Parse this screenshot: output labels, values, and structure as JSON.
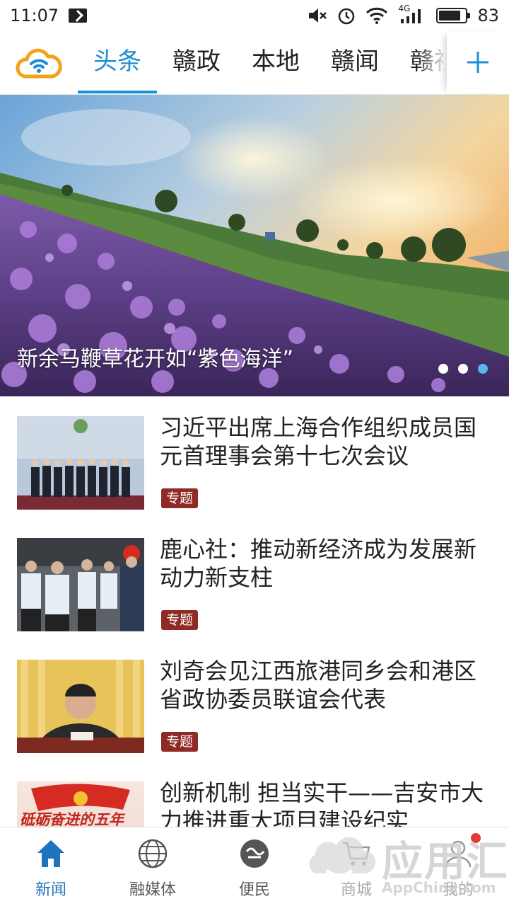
{
  "status_bar": {
    "time": "11:07",
    "battery_level": "83",
    "network": "4G"
  },
  "header": {
    "tabs": [
      {
        "label": "头条",
        "active": true
      },
      {
        "label": "赣政",
        "active": false
      },
      {
        "label": "本地",
        "active": false
      },
      {
        "label": "赣闻",
        "active": false
      },
      {
        "label": "赣社",
        "active": false
      }
    ],
    "add_icon": "plus-icon",
    "accent_color": "#1a8fd4"
  },
  "hero": {
    "caption": "新余马鞭草花开如“紫色海洋”",
    "slide_count": 3,
    "active_slide": 3
  },
  "news": [
    {
      "title": "习近平出席上海合作组织成员国元首理事会第十七次会议",
      "tag": "专题"
    },
    {
      "title": "鹿心社：推动新经济成为发展新动力新支柱",
      "tag": "专题"
    },
    {
      "title": "刘奇会见江西旅港同乡会和港区省政协委员联谊会代表",
      "tag": "专题"
    },
    {
      "title": "创新机制 担当实干——吉安市大力推进重大项目建设纪实",
      "tag": "",
      "thumb_text": "砥砺奋进的五年"
    }
  ],
  "bottom_nav": [
    {
      "label": "新闻",
      "icon": "home-icon",
      "active": true
    },
    {
      "label": "融媒体",
      "icon": "globe-icon",
      "active": false
    },
    {
      "label": "便民",
      "icon": "service-icon",
      "active": false
    },
    {
      "label": "商城",
      "icon": "cart-icon",
      "active": false
    },
    {
      "label": "我的",
      "icon": "user-icon",
      "active": false
    }
  ],
  "watermark": {
    "text": "应用汇",
    "sub": "AppChina.com"
  }
}
